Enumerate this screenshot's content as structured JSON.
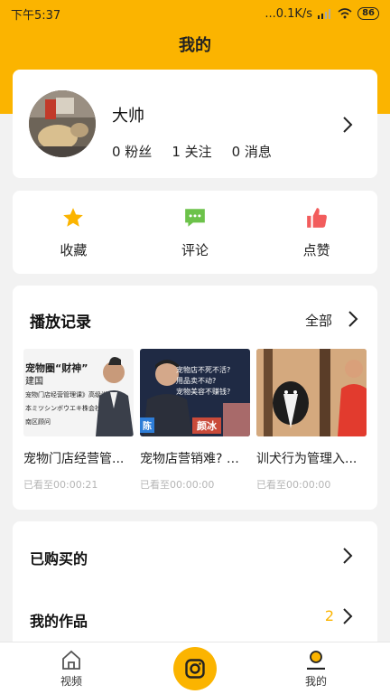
{
  "status_bar": {
    "time": "下午5:37",
    "network": "...0.1K/s",
    "battery": "86"
  },
  "header": {
    "title": "我的"
  },
  "profile": {
    "name": "大帅",
    "fans": "0 粉丝",
    "follows": "1 关注",
    "messages": "0 消息"
  },
  "actions": [
    {
      "label": "收藏",
      "icon": "star-icon",
      "color": "#fbb400"
    },
    {
      "label": "评论",
      "icon": "comment-icon",
      "color": "#6cc24a"
    },
    {
      "label": "点赞",
      "icon": "thumbs-up-icon",
      "color": "#f25c5c"
    }
  ],
  "history": {
    "title": "播放记录",
    "see_all": "全部",
    "items": [
      {
        "title": "宠物门店经营管...",
        "progress": "已看至00:00:21",
        "thumb_lines": [
          "宠物圈“财神”",
          "建国",
          "宠物门店经营管理课》高级讲师",
          "本ミツシンボウエキ株会社",
          "南区顾问"
        ]
      },
      {
        "title": "宠物店营销难? 干...",
        "progress": "已看至00:00:00",
        "thumb_lines": [
          "宠物店不死不活?",
          "用品卖不动?",
          "宠物美容不赚钱?",
          "颜冰",
          "陈"
        ]
      },
      {
        "title": "训犬行为管理入...",
        "progress": "已看至00:00:00",
        "thumb_lines": []
      }
    ]
  },
  "list": [
    {
      "label": "已购买的",
      "count": ""
    },
    {
      "label": "我的作品",
      "count": "2"
    }
  ],
  "nav": {
    "video": "视频",
    "mine": "我的"
  },
  "colors": {
    "accent": "#fbb400"
  }
}
